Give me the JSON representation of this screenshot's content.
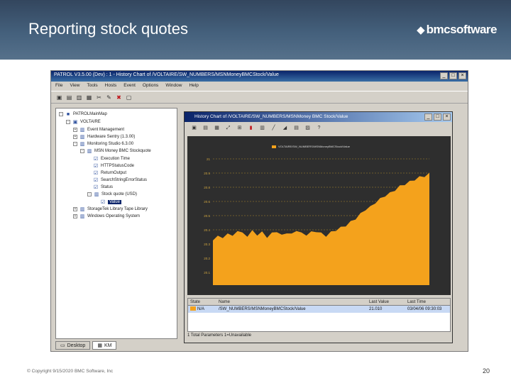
{
  "slide": {
    "title": "Reporting stock quotes",
    "logo_text": "bmcsoftware",
    "footer_copyright": "© Copyright 9/15/2020 BMC Software, Inc",
    "page_number": "20"
  },
  "app": {
    "title": "PATROL   V3.5.00 (Dev) : 1 - History Chart of /VOLTAIRE/SW_NUMBERS/MSNMoneyBMCStock/Value",
    "menu": [
      "File",
      "View",
      "Tools",
      "Hosts",
      "Event",
      "Options",
      "Window",
      "Help"
    ],
    "tree": {
      "items": [
        {
          "label": "PATROLMainMap",
          "icon": "map-icon",
          "expander": "-"
        },
        {
          "label": "VOLTAIRE",
          "icon": "computer-icon",
          "expander": "-"
        },
        {
          "label": "Event Management",
          "icon": "application-icon",
          "expander": "+"
        },
        {
          "label": "Hardware Sentry (1.3.00)",
          "icon": "application-icon",
          "expander": "+"
        },
        {
          "label": "Monitoring Studio 6.3.00",
          "icon": "application-icon",
          "expander": "-"
        },
        {
          "label": "MSN Money BMC Stockquote",
          "icon": "application-icon",
          "expander": "-"
        },
        {
          "label": "Execution Time",
          "icon": "parameter-icon",
          "expander": ""
        },
        {
          "label": "HTTPStatusCode",
          "icon": "parameter-icon",
          "expander": ""
        },
        {
          "label": "ReturnOutput",
          "icon": "parameter-icon",
          "expander": ""
        },
        {
          "label": "SearchStringErrorStatus",
          "icon": "parameter-icon",
          "expander": ""
        },
        {
          "label": "Status",
          "icon": "parameter-icon",
          "expander": ""
        },
        {
          "label": "Stock quote (USD)",
          "icon": "application-icon",
          "expander": "-"
        },
        {
          "label": "Value",
          "icon": "parameter-icon",
          "expander": ""
        },
        {
          "label": "StorageTek Library Tape Library",
          "icon": "application-icon",
          "expander": "+"
        },
        {
          "label": "Windows Operating System",
          "icon": "application-icon",
          "expander": "+"
        }
      ]
    },
    "tabs": [
      {
        "label": "Desktop",
        "icon": "desktop-icon"
      },
      {
        "label": "KM",
        "icon": "km-icon"
      }
    ],
    "history_chart": {
      "title": "History Chart of /VOLTAIRE/SW_NUMBERS/MSNMoney BMC Stock/Value",
      "legend": "VOLTAIRE/SW_NUMBERS/MSNMoneyBMCStock/Value",
      "columns": [
        "State",
        "Name",
        "Last Value",
        "Last Time"
      ],
      "rows": [
        {
          "state": "N/A",
          "name": "/SW_NUMBERS/MSNMoneyBMCStock/Value",
          "last_value": "21.010",
          "last_time": "03/04/06 09:30:03"
        }
      ],
      "status_bar": "1 Total Parameters   1=Unavailable"
    }
  },
  "chart_data": {
    "type": "area",
    "title": "",
    "color": "#f4a21c",
    "background": "#2e2e2e",
    "yticks": [
      "21",
      "20.9",
      "20.8",
      "20.6",
      "20.5",
      "20.4",
      "20.3",
      "20.2",
      "20.1"
    ],
    "ylim": [
      20.0,
      21.1
    ],
    "grid": true,
    "values": [
      20.38,
      20.44,
      20.4,
      20.46,
      20.42,
      20.48,
      20.45,
      20.43,
      20.47,
      20.44,
      20.46,
      20.42,
      20.45,
      20.47,
      20.43,
      20.46,
      20.44,
      20.48,
      20.45,
      20.44,
      20.46,
      20.47,
      20.45,
      20.43,
      20.46,
      20.48,
      20.5,
      20.52,
      20.55,
      20.58,
      20.62,
      20.66,
      20.68,
      20.72,
      20.75,
      20.78,
      20.8,
      20.83,
      20.86,
      20.88,
      20.9,
      20.92,
      20.94,
      20.95,
      20.97
    ]
  }
}
